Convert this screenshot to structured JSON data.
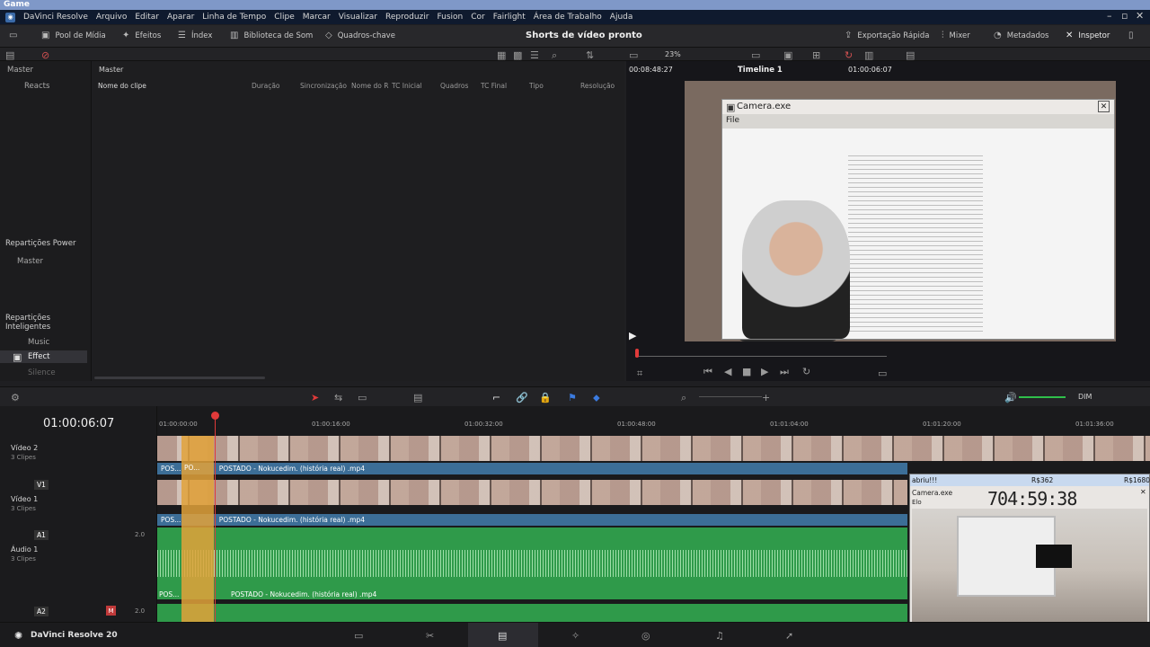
{
  "window": {
    "title": "Game"
  },
  "menu": [
    "DaVinci Resolve",
    "Arquivo",
    "Editar",
    "Aparar",
    "Linha de Tempo",
    "Clipe",
    "Marcar",
    "Visualizar",
    "Reproduzir",
    "Fusion",
    "Cor",
    "Fairlight",
    "Área de Trabalho",
    "Ajuda"
  ],
  "toolbar": {
    "pool": "Pool de Mídia",
    "effects": "Efeitos",
    "index": "Índex",
    "soundlib": "Biblioteca de Som",
    "keywords": "Quadros-chave",
    "project": "Shorts de vídeo pronto",
    "quickexport": "Exportação Rápida",
    "mixer": "Mixer",
    "metadata": "Metadados",
    "inspector": "Inspetor"
  },
  "subtool": {
    "zoom": "23%",
    "tc_left": "00:08:48:27",
    "timeline": "Timeline 1",
    "tc_right": "01:00:06:07"
  },
  "media": {
    "master_label": "Master",
    "columns": [
      "Nome do clipe",
      "Duração",
      "Sincronização",
      "Nome do R",
      "TC Inicial",
      "Quadros",
      "TC Final",
      "Tipo",
      "Resolução"
    ]
  },
  "leftpanel": {
    "master": "Master",
    "reacts": "Reacts",
    "power_bins": "Repartições Power",
    "power_master": "Master",
    "smart_bins": "Repartições Inteligentes",
    "music": "Music",
    "effect": "Effect",
    "silence": "Silence"
  },
  "camera_window": {
    "title": "Camera.exe",
    "menu": "File"
  },
  "timeline": {
    "timecode": "01:00:06:07",
    "ruler": [
      "01:00:00:00",
      "01:00:16:00",
      "01:00:32:00",
      "01:00:48:00",
      "01:01:04:00",
      "01:01:20:00",
      "01:01:36:00"
    ],
    "dim": "DIM",
    "tracks": [
      {
        "id": "",
        "name": "Vídeo 2",
        "clips": "3 Clipes"
      },
      {
        "id": "V1",
        "name": "Vídeo 1",
        "clips": "3 Clipes"
      },
      {
        "id": "A1",
        "name": "Áudio 1",
        "clips": "3 Clipes",
        "level": "2.0"
      },
      {
        "id": "A2",
        "name": "",
        "clips": "",
        "level": "2.0"
      }
    ],
    "clip_name": "POSTADO - Nokucedim. (história real) .mp4",
    "clip_short1": "POS...",
    "clip_short2": "PO..."
  },
  "overlay": {
    "tag": "abriu!!!",
    "min": "R$362",
    "max": "R$1680",
    "cam_title": "Camera.exe",
    "cam_menu": "Elo",
    "timer": "704:59:38"
  },
  "status": {
    "app": "DaVinci Resolve 20"
  },
  "colors": {
    "accent_red": "#e03a3a",
    "clip_blue": "#3c6e97",
    "audio_green": "#2f9a4a",
    "clip_orange": "#e2a23a"
  }
}
